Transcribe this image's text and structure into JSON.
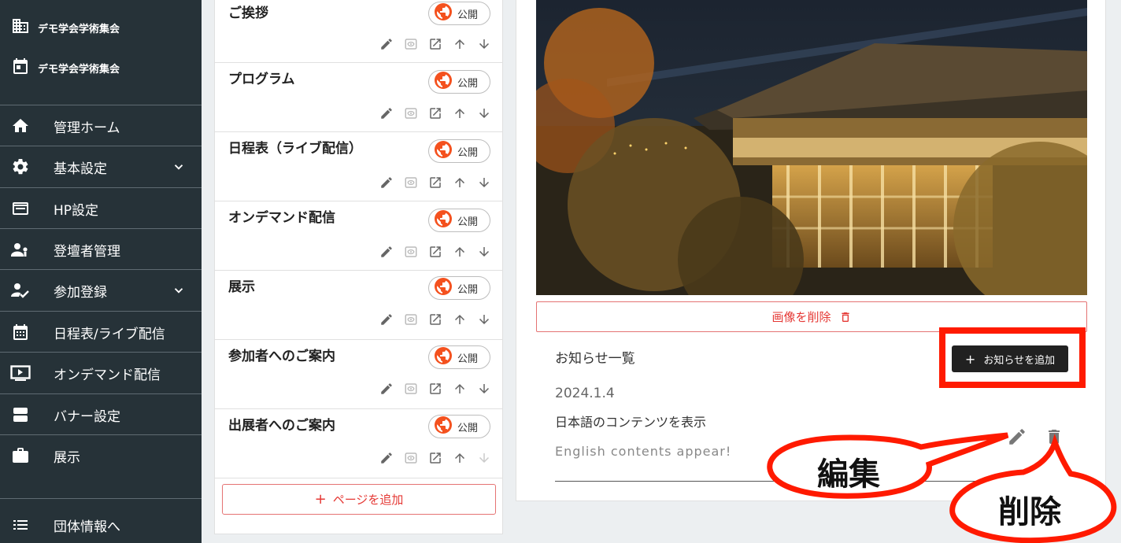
{
  "sidebar": {
    "org_top": "デモ学会学術集会",
    "org_event": "デモ学会学術集会",
    "items": [
      {
        "label": "管理ホーム",
        "icon": "home-icon"
      },
      {
        "label": "基本設定",
        "icon": "gear-icon",
        "expandable": true
      },
      {
        "label": "HP設定",
        "icon": "browser-icon"
      },
      {
        "label": "登壇者管理",
        "icon": "speakers-icon"
      },
      {
        "label": "参加登録",
        "icon": "person-check-icon",
        "expandable": true
      },
      {
        "label": "日程表/ライブ配信",
        "icon": "calendar-icon"
      },
      {
        "label": "オンデマンド配信",
        "icon": "video-icon"
      },
      {
        "label": "バナー設定",
        "icon": "banner-icon"
      },
      {
        "label": "展示",
        "icon": "briefcase-icon"
      }
    ],
    "footer": {
      "label": "団体情報へ",
      "icon": "list-icon"
    }
  },
  "pages": {
    "items": [
      {
        "title": "ご挨拶",
        "status": "公開"
      },
      {
        "title": "プログラム",
        "status": "公開"
      },
      {
        "title": "日程表（ライブ配信）",
        "status": "公開"
      },
      {
        "title": "オンデマンド配信",
        "status": "公開"
      },
      {
        "title": "展示",
        "status": "公開"
      },
      {
        "title": "参加者へのご案内",
        "status": "公開"
      },
      {
        "title": "出展者へのご案内",
        "status": "公開"
      }
    ],
    "add_label": "ページを追加"
  },
  "detail": {
    "delete_image_label": "画像を削除",
    "news_heading": "お知らせ一覧",
    "add_news_label": "お知らせを追加",
    "news": {
      "date": "2024.1.4",
      "ja": "日本語のコンテンツを表示",
      "en": "English contents appear!"
    }
  },
  "annotations": {
    "edit": "編集",
    "delete": "削除"
  },
  "colors": {
    "sidebar_bg": "#263238",
    "accent_red": "#e53935",
    "annotation_red": "#ff1a00",
    "button_dark": "#212121"
  }
}
